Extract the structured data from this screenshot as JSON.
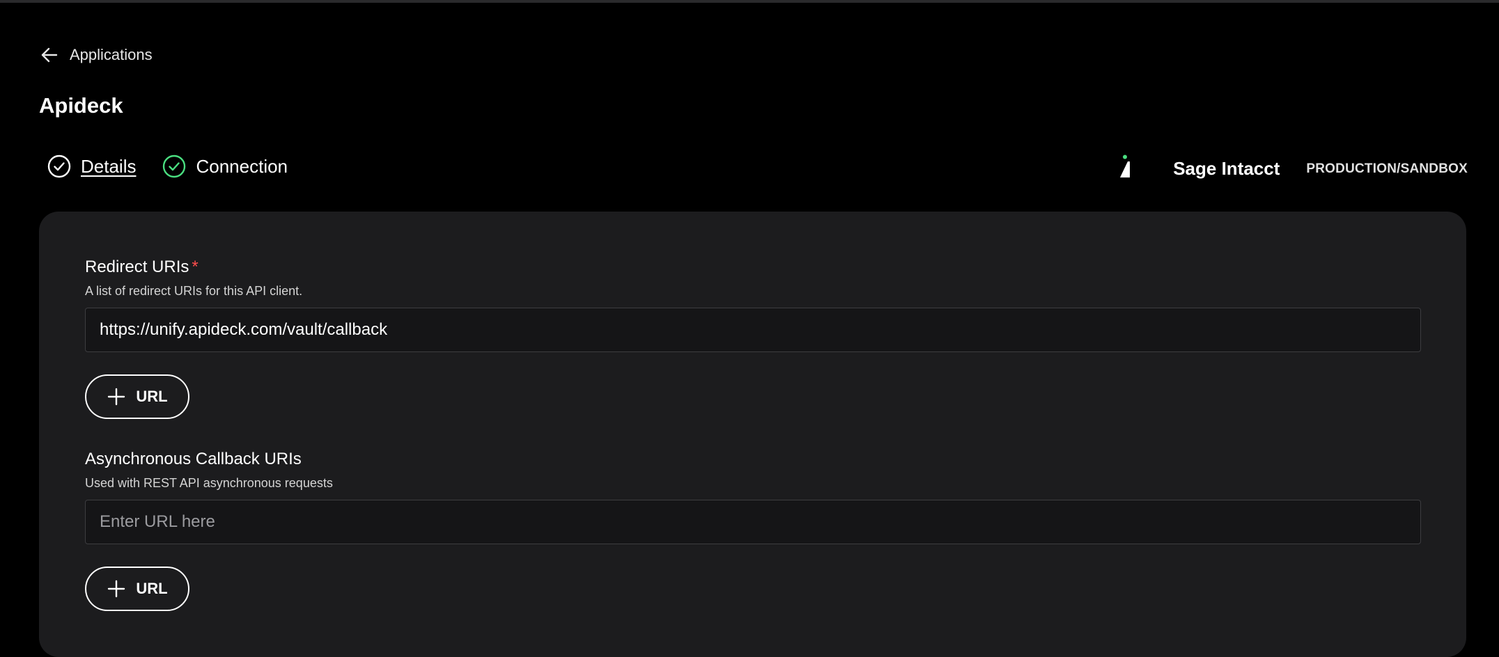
{
  "nav": {
    "back_label": "Applications",
    "back_icon": "arrow-left-icon"
  },
  "page": {
    "title": "Apideck"
  },
  "steps": [
    {
      "label": "Details",
      "icon": "check-circle-icon",
      "active": true,
      "color": "#ffffff"
    },
    {
      "label": "Connection",
      "icon": "check-circle-icon",
      "active": false,
      "color": "#4ade80"
    }
  ],
  "brand": {
    "name": "Sage Intacct",
    "environment": "PRODUCTION/SANDBOX",
    "logo_icon": "sage-intacct-logo-icon",
    "accent_color": "#4ade80"
  },
  "form": {
    "redirect": {
      "label": "Redirect URIs",
      "required_marker": "*",
      "help": "A list of redirect URIs for this API client.",
      "value": "https://unify.apideck.com/vault/callback",
      "add_button_label": "URL"
    },
    "async": {
      "label": "Asynchronous Callback URIs",
      "help": "Used with REST API asynchronous requests",
      "value": "",
      "placeholder": "Enter URL here",
      "add_button_label": "URL"
    }
  },
  "colors": {
    "background": "#000000",
    "panel": "#1c1c1e",
    "required": "#ff4d4d",
    "success": "#4ade80"
  }
}
